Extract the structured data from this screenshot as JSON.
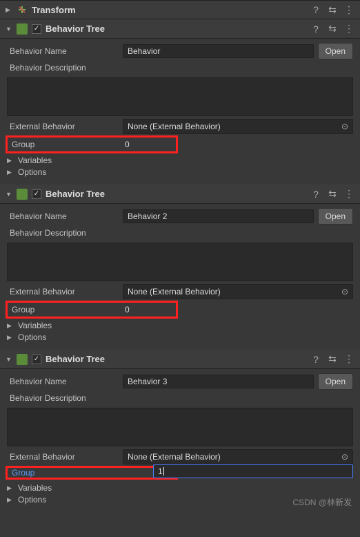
{
  "transform": {
    "title": "Transform"
  },
  "components": [
    {
      "title": "Behavior Tree",
      "enabled": "✓",
      "fields": {
        "behaviorName": {
          "label": "Behavior Name",
          "value": "Behavior"
        },
        "behaviorDesc": {
          "label": "Behavior Description",
          "value": ""
        },
        "externalBehavior": {
          "label": "External Behavior",
          "value": "None (External Behavior)"
        },
        "group": {
          "label": "Group",
          "value": "0"
        },
        "variables": "Variables",
        "options": "Options",
        "openBtn": "Open"
      }
    },
    {
      "title": "Behavior Tree",
      "enabled": "✓",
      "fields": {
        "behaviorName": {
          "label": "Behavior Name",
          "value": "Behavior 2"
        },
        "behaviorDesc": {
          "label": "Behavior Description",
          "value": ""
        },
        "externalBehavior": {
          "label": "External Behavior",
          "value": "None (External Behavior)"
        },
        "group": {
          "label": "Group",
          "value": "0"
        },
        "variables": "Variables",
        "options": "Options",
        "openBtn": "Open"
      }
    },
    {
      "title": "Behavior Tree",
      "enabled": "✓",
      "fields": {
        "behaviorName": {
          "label": "Behavior Name",
          "value": "Behavior 3"
        },
        "behaviorDesc": {
          "label": "Behavior Description",
          "value": ""
        },
        "externalBehavior": {
          "label": "External Behavior",
          "value": "None (External Behavior)"
        },
        "group": {
          "label": "Group",
          "value": "1"
        },
        "variables": "Variables",
        "options": "Options",
        "openBtn": "Open"
      }
    }
  ],
  "watermark": "CSDN @林新发"
}
